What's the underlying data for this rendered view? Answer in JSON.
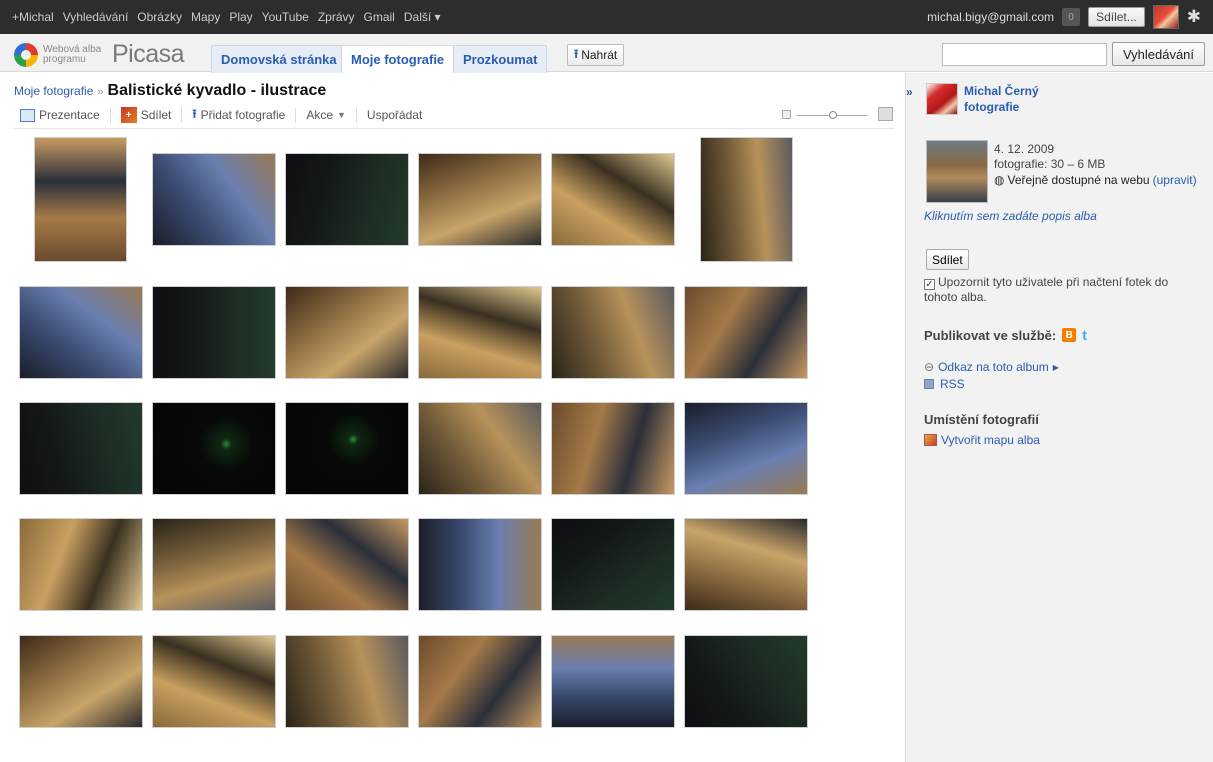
{
  "gbar": {
    "links": [
      "+Michal",
      "Vyhledávání",
      "Obrázky",
      "Mapy",
      "Play",
      "YouTube",
      "Zprávy",
      "Gmail",
      "Další ▾"
    ],
    "email": "michal.bigy@gmail.com",
    "notifications": "0",
    "share_label": "Sdílet..."
  },
  "header": {
    "logo_small": "Webová alba programu",
    "logo_big": "Picasa",
    "tabs": [
      "Domovská stránka",
      "Moje fotografie",
      "Prozkoumat"
    ],
    "active_tab": "Moje fotografie",
    "upload_label": "Nahrát",
    "search_placeholder": "",
    "search_button": "Vyhledávání"
  },
  "album": {
    "breadcrumb_root": "Moje fotografie",
    "title": "Balistické kyvadlo - ilustrace",
    "toolbar": {
      "slideshow": "Prezentace",
      "share": "Sdílet",
      "add_photos": "Přidat fotografie",
      "actions": "Akce",
      "arrange": "Uspořádat"
    },
    "photo_count": 30
  },
  "sidebar": {
    "owner_name": "Michal Černý",
    "owner_sub": "fotografie",
    "date": "4. 12. 2009",
    "count_size": "fotografie: 30 – 6 MB",
    "visibility": "Veřejně dostupné na webu",
    "edit_link": "(upravit)",
    "description_prompt": "Kliknutím sem zadáte popis alba",
    "share_button": "Sdílet",
    "notify_text": "Upozornit tyto uživatele při načtení fotek do tohoto alba.",
    "notify_checked": true,
    "publish_label": "Publikovat ve službě:",
    "album_link": "Odkaz na toto album",
    "rss": "RSS",
    "places_title": "Umístění fotografií",
    "map_link": "Vytvořit mapu alba"
  },
  "colors": {
    "link": "#2a5db0",
    "gbar_bg": "#2d2d2d",
    "sidebar_bg": "#f2f2f2"
  }
}
